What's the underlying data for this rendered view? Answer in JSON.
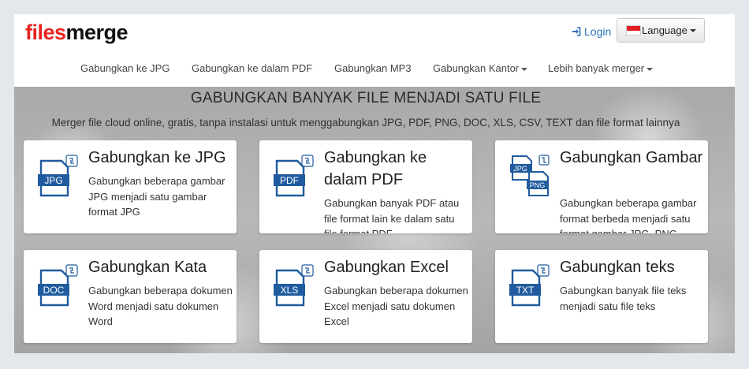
{
  "brand": {
    "logo_part1": "files",
    "logo_part2": "merge"
  },
  "header": {
    "login": "Login",
    "language": "Language"
  },
  "nav": {
    "items": [
      {
        "label": "Gabungkan ke JPG",
        "dropdown": false
      },
      {
        "label": "Gabungkan ke dalam PDF",
        "dropdown": false
      },
      {
        "label": "Gabungkan MP3",
        "dropdown": false
      },
      {
        "label": "Gabungkan Kantor",
        "dropdown": true
      },
      {
        "label": "Lebih banyak merger",
        "dropdown": true
      }
    ]
  },
  "hero": {
    "title": "GABUNGKAN BANYAK FILE MENJADI SATU FILE",
    "subtitle": "Merger file cloud online, gratis, tanpa instalasi untuk menggabungkan JPG, PDF, PNG, DOC, XLS, CSV, TEXT dan file format lainnya"
  },
  "cards": [
    {
      "title": "Gabungkan ke JPG",
      "desc": "Gabungkan beberapa gambar JPG menjadi satu gambar format JPG",
      "icon": "jpg-file-icon",
      "icon_label": "JPG"
    },
    {
      "title": "Gabungkan ke dalam PDF",
      "desc": "Gabungkan banyak PDF atau file format lain ke dalam satu file format PDF",
      "icon": "pdf-file-icon",
      "icon_label": "PDF"
    },
    {
      "title": "Gabungkan Gambar",
      "desc": "Gabungkan beberapa gambar format berbeda menjadi satu format gambar JPG, PNG, BMP, GIF",
      "icon": "jpg-png-file-icon",
      "icon_label": "JPG",
      "icon_label2": "PNG"
    },
    {
      "title": "Gabungkan Kata",
      "desc": "Gabungkan beberapa dokumen Word menjadi satu dokumen Word",
      "icon": "doc-file-icon",
      "icon_label": "DOC"
    },
    {
      "title": "Gabungkan Excel",
      "desc": "Gabungkan beberapa dokumen Excel menjadi satu dokumen Excel",
      "icon": "xls-file-icon",
      "icon_label": "XLS"
    },
    {
      "title": "Gabungkan teks",
      "desc": "Gabungkan banyak file teks menjadi satu file teks",
      "icon": "txt-file-icon",
      "icon_label": "TXT"
    }
  ],
  "colors": {
    "accent": "#1f5b9e",
    "logo_red": "#e8231f",
    "link": "#2a6fbb",
    "flag_red": "#e21c23"
  }
}
